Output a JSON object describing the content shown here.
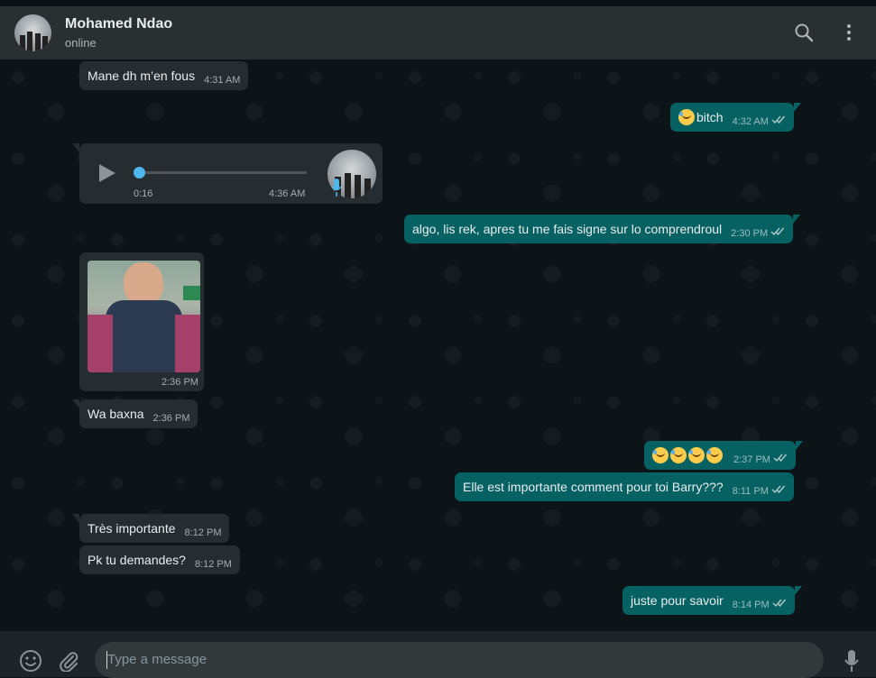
{
  "header": {
    "name": "Mohamed Ndao",
    "status": "online",
    "icons": [
      "search-icon",
      "menu-icon"
    ]
  },
  "messages": [
    {
      "dir": "in",
      "text": "Mane dh m’en fous",
      "time": "4:31 AM"
    },
    {
      "dir": "out",
      "text": "bitch",
      "time": "4:32 AM",
      "emoji": "face-with-tears-icon"
    },
    {
      "dir": "in",
      "type": "voice",
      "duration": "0:16",
      "time": "4:36 AM",
      "progress": 0.0
    },
    {
      "dir": "out",
      "text": "algo, lis rek, apres tu me fais signe sur lo comprendroul",
      "time": "2:30 PM"
    },
    {
      "dir": "in",
      "type": "image",
      "time": "2:36 PM"
    },
    {
      "dir": "in",
      "text": "Wa baxna",
      "time": "2:36 PM"
    },
    {
      "dir": "out",
      "text": "",
      "emojis": "4x face-with-tears-of-joy-icon",
      "time": "2:37 PM"
    },
    {
      "dir": "out",
      "text": "Elle est importante comment pour toi Barry???",
      "time": "8:11 PM"
    },
    {
      "dir": "in",
      "text": "Très importante",
      "time": "8:12 PM"
    },
    {
      "dir": "in",
      "text": "Pk tu demandes?",
      "time": "8:12 PM"
    },
    {
      "dir": "out",
      "text": "juste pour savoir",
      "time": "8:14 PM"
    }
  ],
  "composer": {
    "placeholder": "Type a message",
    "icons": [
      "emoji-icon",
      "attach-icon",
      "microphone-icon"
    ]
  },
  "colors": {
    "background": "#0d1418",
    "header": "#2a2f32",
    "incoming": "#262d31",
    "outgoing": "#056162",
    "accent": "#34b7f1"
  }
}
